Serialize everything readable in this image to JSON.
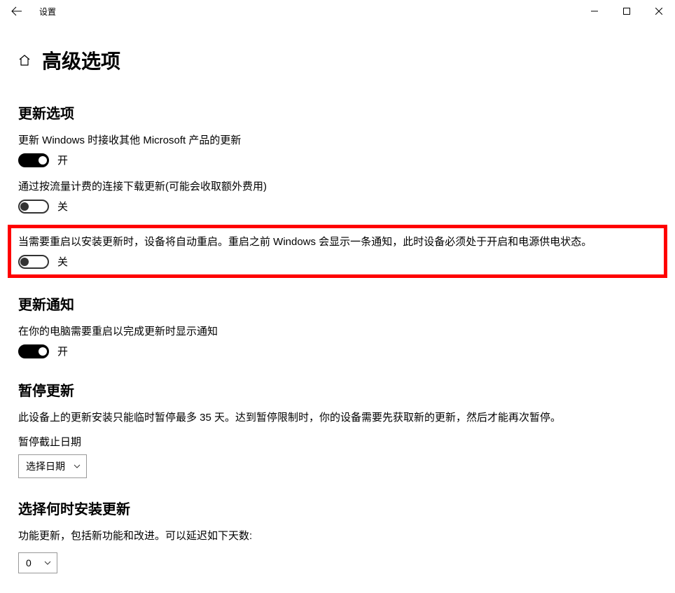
{
  "titlebar": {
    "app_name": "设置"
  },
  "page": {
    "title": "高级选项"
  },
  "sections": {
    "update_options": {
      "heading": "更新选项",
      "items": [
        {
          "label": "更新 Windows 时接收其他 Microsoft 产品的更新",
          "state_text": "开",
          "on": true
        },
        {
          "label": "通过按流量计费的连接下载更新(可能会收取额外费用)",
          "state_text": "关",
          "on": false
        },
        {
          "label": "当需要重启以安装更新时，设备将自动重启。重启之前 Windows 会显示一条通知，此时设备必须处于开启和电源供电状态。",
          "state_text": "关",
          "on": false
        }
      ]
    },
    "update_notifications": {
      "heading": "更新通知",
      "item": {
        "label": "在你的电脑需要重启以完成更新时显示通知",
        "state_text": "开",
        "on": true
      }
    },
    "pause_updates": {
      "heading": "暂停更新",
      "description": "此设备上的更新安装只能临时暂停最多 35 天。达到暂停限制时，你的设备需要先获取新的更新，然后才能再次暂停。",
      "label": "暂停截止日期",
      "dropdown_value": "选择日期"
    },
    "choose_install": {
      "heading": "选择何时安装更新",
      "description": "功能更新，包括新功能和改进。可以延迟如下天数:",
      "dropdown_value": "0"
    }
  }
}
